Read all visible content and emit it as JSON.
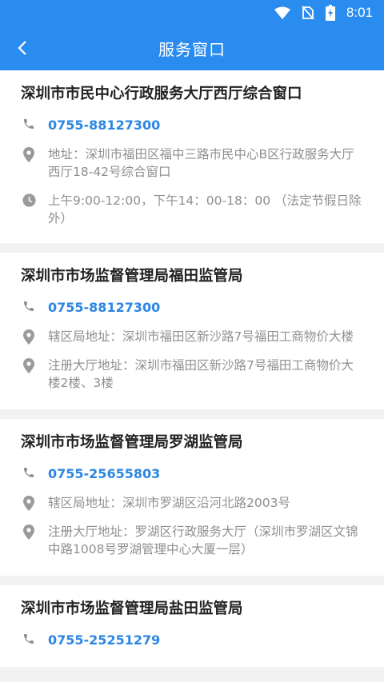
{
  "status": {
    "time": "8:01"
  },
  "header": {
    "title": "服务窗口"
  },
  "cards": [
    {
      "name": "深圳市市民中心行政服务大厅西厅综合窗口",
      "phone": "0755-88127300",
      "rows": [
        {
          "icon": "location-icon",
          "text": "地址：深圳市福田区福中三路市民中心B区行政服务大厅西厅18-42号综合窗口"
        },
        {
          "icon": "clock-icon",
          "text": "上午9:00-12:00，下午14：00-18：00 （法定节假日除外）"
        }
      ]
    },
    {
      "name": "深圳市市场监督管理局福田监管局",
      "phone": "0755-88127300",
      "rows": [
        {
          "icon": "location-icon",
          "text": "辖区局地址：深圳市福田区新沙路7号福田工商物价大楼"
        },
        {
          "icon": "location-icon",
          "text": "注册大厅地址：深圳市福田区新沙路7号福田工商物价大楼2楼、3楼"
        }
      ]
    },
    {
      "name": "深圳市市场监督管理局罗湖监管局",
      "phone": "0755-25655803",
      "rows": [
        {
          "icon": "location-icon",
          "text": "辖区局地址：深圳市罗湖区沿河北路2003号"
        },
        {
          "icon": "location-icon",
          "text": "注册大厅地址：罗湖区行政服务大厅（深圳市罗湖区文锦中路1008号罗湖管理中心大厦一层）"
        }
      ]
    },
    {
      "name": "深圳市市场监督管理局盐田监管局",
      "phone": "0755-25251279",
      "rows": []
    }
  ]
}
